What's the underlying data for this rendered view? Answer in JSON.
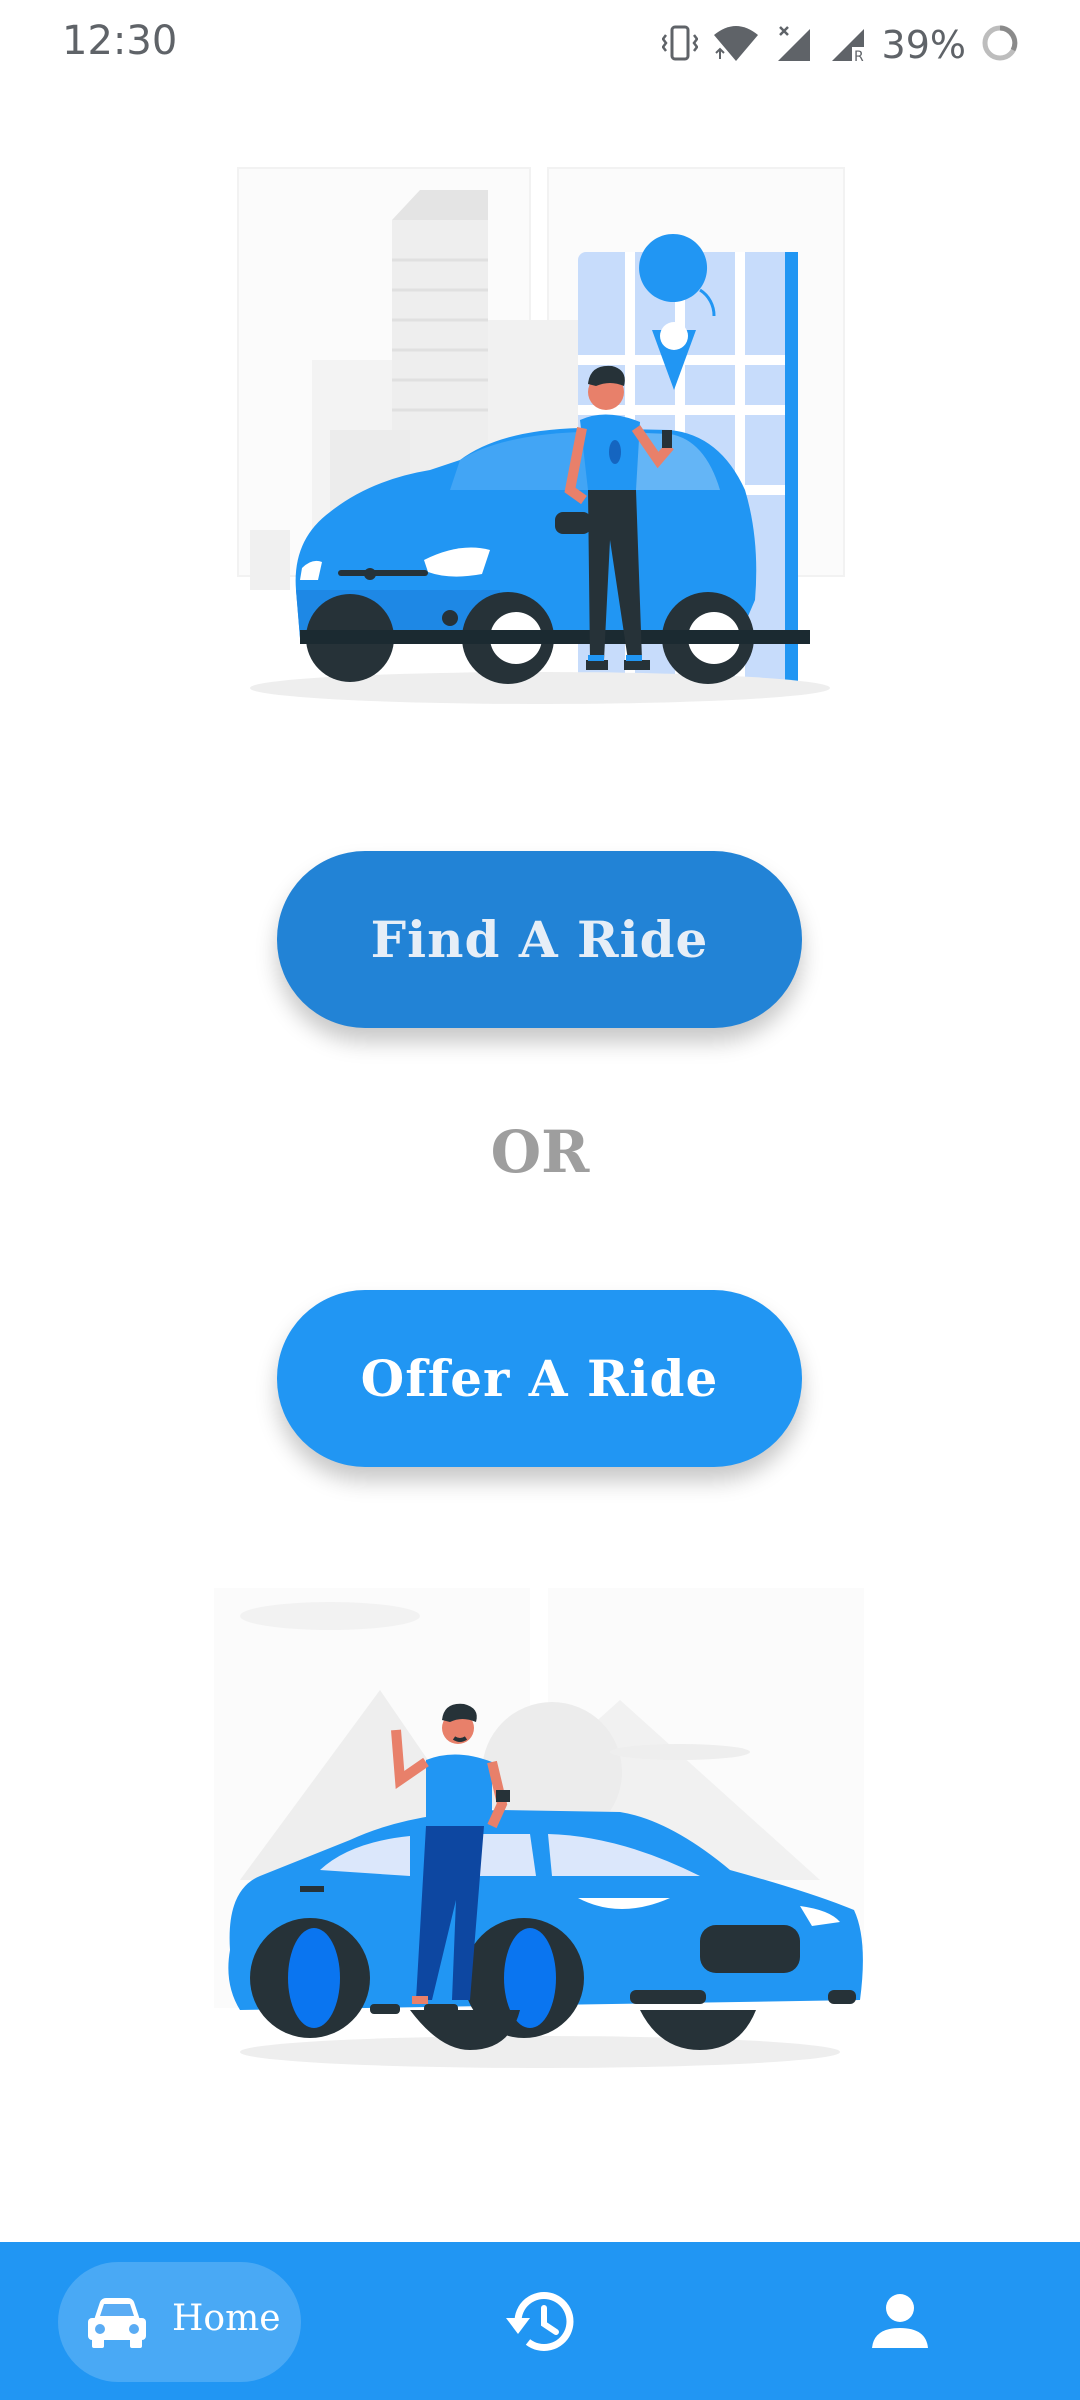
{
  "status_bar": {
    "time": "12:30",
    "battery_percent": "39%",
    "icons": [
      "vibrate-icon",
      "wifi-icon",
      "signal-x-icon",
      "signal-r-icon",
      "battery-ring-icon"
    ]
  },
  "main": {
    "find_ride_label": "Find A Ride",
    "or_label": "OR",
    "offer_ride_label": "Offer A Ride"
  },
  "bottom_nav": {
    "items": [
      {
        "label": "Home",
        "icon": "car-icon",
        "selected": true
      },
      {
        "label": "",
        "icon": "history-icon",
        "selected": false
      },
      {
        "label": "",
        "icon": "person-icon",
        "selected": false
      }
    ]
  },
  "colors": {
    "primary": "#2196f3",
    "find_button": "#2283d6",
    "or_text": "#9e9e9e"
  }
}
